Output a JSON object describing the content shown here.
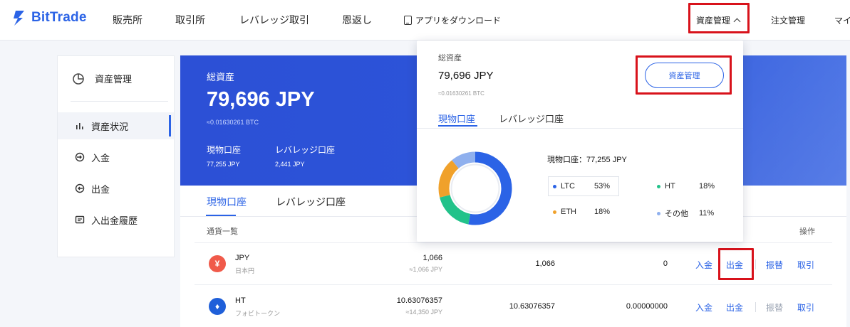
{
  "brand": {
    "name": "BitTrade",
    "color": "#2b63e6"
  },
  "nav": {
    "items": [
      "販売所",
      "取引所",
      "レバレッジ取引",
      "恩返し"
    ],
    "app_download": "アプリをダウンロード",
    "asset_mgmt": "資産管理",
    "orders": "注文管理",
    "mypage": "マイ"
  },
  "sidebar": {
    "header": "資産管理",
    "items": [
      {
        "label": "資産状況",
        "icon": "bar-chart-icon",
        "active": true
      },
      {
        "label": "入金",
        "icon": "deposit-icon",
        "active": false
      },
      {
        "label": "出金",
        "icon": "withdraw-icon",
        "active": false
      },
      {
        "label": "入出金履歴",
        "icon": "history-icon",
        "active": false
      }
    ]
  },
  "summary": {
    "title": "総資産",
    "amount": "79,696 JPY",
    "btc": "≈0.01630261 BTC",
    "spot_label": "現物口座",
    "spot_value": "77,255 JPY",
    "leverage_label": "レバレッジ口座",
    "leverage_value": "2,441 JPY"
  },
  "main": {
    "tabs": [
      "現物口座",
      "レバレッジ口座"
    ],
    "list_label": "通貨一覧",
    "op_label": "操作",
    "rows": [
      {
        "symbol": "JPY",
        "name": "日本円",
        "icon": "yen-icon",
        "icon_char": "¥",
        "color": "#f05a4a",
        "total": "1,066",
        "total_jpy": "≈1,066 JPY",
        "available": "1,066",
        "frozen": "0",
        "actions": [
          "入金",
          "出金",
          "振替",
          "取引"
        ]
      },
      {
        "symbol": "HT",
        "name": "フォビトークン",
        "icon": "ht-flame-icon",
        "icon_char": "♦",
        "color": "#1f5fd9",
        "total": "10.63076357",
        "total_jpy": "≈14,350 JPY",
        "available": "10.63076357",
        "frozen": "0.00000000",
        "actions": [
          "入金",
          "出金",
          "振替",
          "取引"
        ]
      }
    ]
  },
  "dropdown": {
    "title": "総資産",
    "amount": "79,696 JPY",
    "btc": "≈0.01630261 BTC",
    "button": "資産管理",
    "tabs": [
      "現物口座",
      "レバレッジ口座"
    ],
    "spot_line": "現物口座：77,255 JPY",
    "legend": [
      {
        "label": "LTC",
        "pct": "53%",
        "color": "#2b63e6"
      },
      {
        "label": "HT",
        "pct": "18%",
        "color": "#22c28a"
      },
      {
        "label": "ETH",
        "pct": "18%",
        "color": "#f0a12b"
      },
      {
        "label": "その他",
        "pct": "11%",
        "color": "#8fb0ee"
      }
    ],
    "donut": [
      {
        "label": "LTC",
        "value": 53,
        "color": "#2b63e6"
      },
      {
        "label": "HT",
        "value": 18,
        "color": "#22c28a"
      },
      {
        "label": "ETH",
        "value": 18,
        "color": "#f0a12b"
      },
      {
        "label": "その他",
        "value": 11,
        "color": "#8fb0ee"
      }
    ]
  }
}
